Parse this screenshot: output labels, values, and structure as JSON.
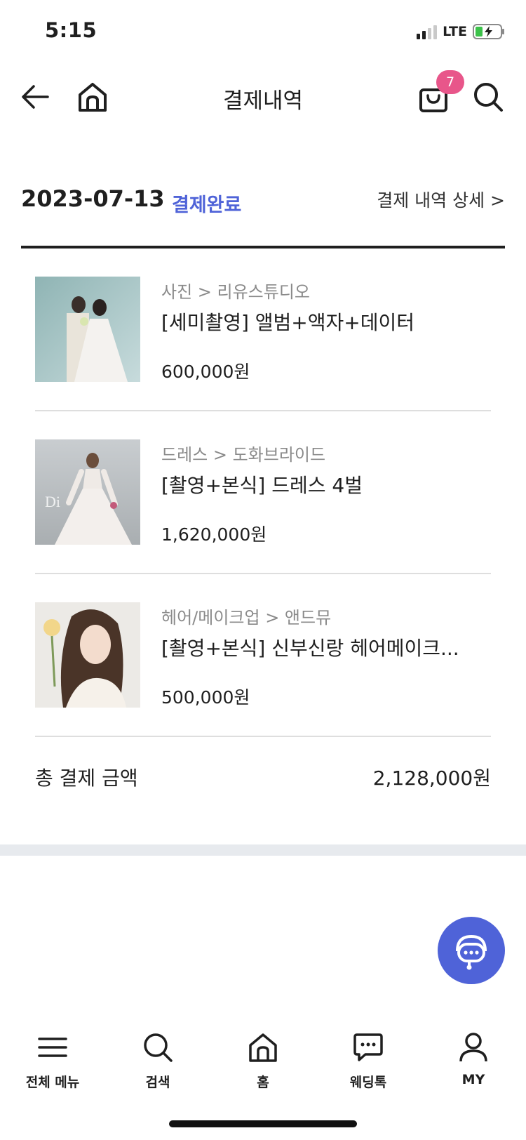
{
  "status_bar": {
    "time": "5:15",
    "network": "LTE"
  },
  "header": {
    "title": "결제내역",
    "cart_count": "7",
    "icons": {
      "back": "arrow-left-icon",
      "home": "home-icon",
      "cart": "shopping-bag-icon",
      "search": "search-icon"
    }
  },
  "order": {
    "date": "2023-07-13",
    "status": "결제완료",
    "detail_link": "결제 내역 상세 >",
    "items": [
      {
        "category": "사진 > 리유스튜디오",
        "name": "[세미촬영] 앨범+액자+데이터",
        "price": "600,000원",
        "image": "wedding couple photo"
      },
      {
        "category": "드레스 > 도화브라이드",
        "name": "[촬영+본식] 드레스 4벌",
        "price": "1,620,000원",
        "image": "wedding dress photo"
      },
      {
        "category": "헤어/메이크업 > 앤드뮤",
        "name": "[촬영+본식] 신부신랑 헤어메이크...",
        "price": "500,000원",
        "image": "bridal makeup portrait"
      }
    ],
    "total_label": "총 결제 금액",
    "total_value": "2,128,000원"
  },
  "bottom_nav": {
    "items": [
      {
        "label": "전체 메뉴",
        "icon": "hamburger-menu-icon"
      },
      {
        "label": "검색",
        "icon": "search-icon"
      },
      {
        "label": "홈",
        "icon": "home-icon"
      },
      {
        "label": "웨딩톡",
        "icon": "chat-bubble-icon"
      },
      {
        "label": "MY",
        "icon": "user-icon"
      }
    ]
  },
  "colors": {
    "accent": "#4f63d8",
    "badge": "#e8568a",
    "divider": "#dedede",
    "section_gap": "#e7eaee"
  }
}
